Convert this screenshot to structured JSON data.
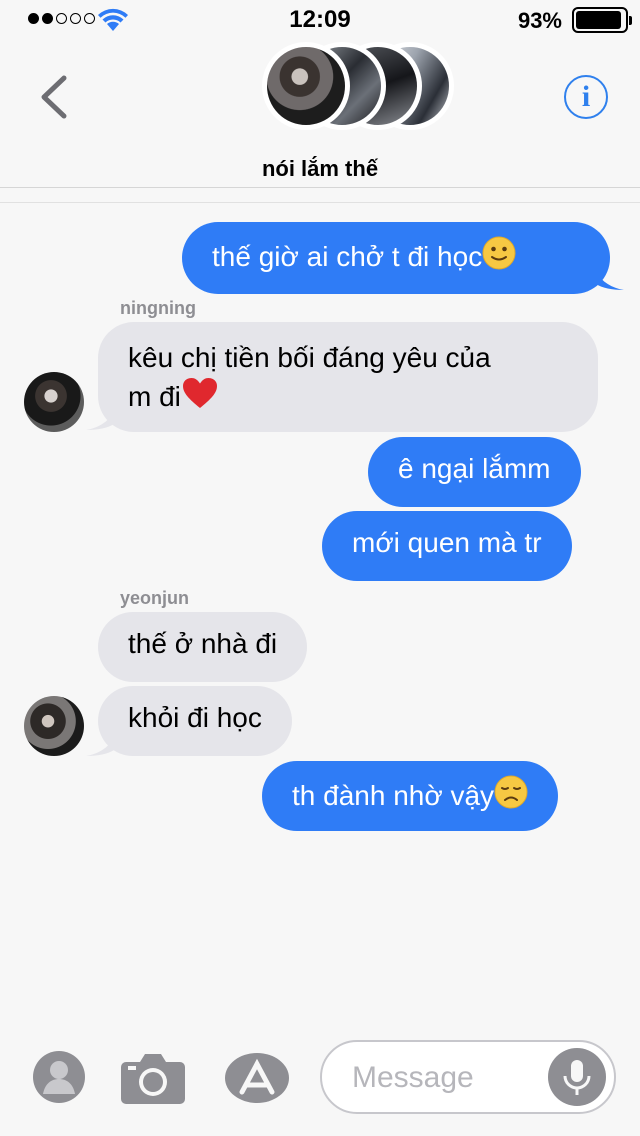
{
  "status_bar": {
    "time": "12:09",
    "battery_percent": "93%",
    "signal_dots_filled": 2,
    "signal_dots_total": 5
  },
  "header": {
    "group_name": "nói lắm thế",
    "info_label": "i",
    "accent": "#2f80ed"
  },
  "messages": [
    {
      "direction": "outgoing",
      "text": "thế giờ ai chở t đi học",
      "emoji": "slightly-smiling-face"
    },
    {
      "direction": "incoming",
      "sender": "ningning",
      "text_line1": "kêu chị tiền bối đáng yêu của",
      "text_line2": "m đi",
      "emoji": "red-heart"
    },
    {
      "direction": "outgoing",
      "text": "ê ngại lắmm"
    },
    {
      "direction": "outgoing",
      "text": "mới quen mà tr"
    },
    {
      "direction": "incoming",
      "sender": "yeonjun",
      "text": "thế ở nhà đi"
    },
    {
      "direction": "incoming",
      "text": "khỏi đi học"
    },
    {
      "direction": "outgoing",
      "text": "th đành nhờ vậy",
      "emoji": "disappointed-face"
    }
  ],
  "input_bar": {
    "placeholder": "Message"
  },
  "colors": {
    "outgoing_bubble": "#2f7cf6",
    "incoming_bubble": "#e5e5ea",
    "sender_label": "#8e8e93"
  }
}
